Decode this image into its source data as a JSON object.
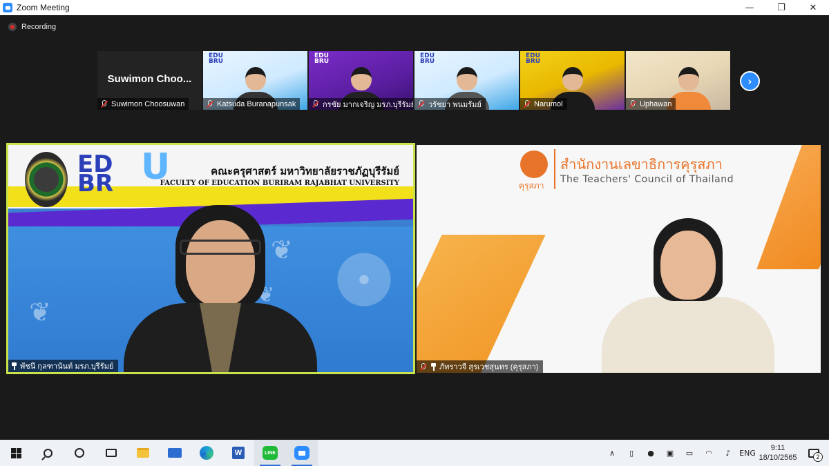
{
  "window": {
    "title": "Zoom Meeting",
    "minimize_glyph": "—",
    "restore_glyph": "❐",
    "close_glyph": "✕"
  },
  "recording": {
    "label": "Recording"
  },
  "thumbnails": [
    {
      "name": "Suwimon Choosuwan",
      "display_text": "Suwimon  Choo...",
      "video": false
    },
    {
      "name": "Katsuda Buranapunsak",
      "video": true
    },
    {
      "name": "กรชัย มากเจริญ มรภ.บุรีรัมย์",
      "video": true
    },
    {
      "name": "วรัชยา พนมรัมย์",
      "video": true
    },
    {
      "name": "Narumol",
      "video": true
    },
    {
      "name": "Uphawan",
      "video": true
    }
  ],
  "next_page_glyph": "›",
  "main_tiles": {
    "left": {
      "name": "พัชนี กุลฑานันท์ มรภ.บุรีรัมย์",
      "faculty_thai": "คณะครุศาสตร์ มหาวิทยาลัยราชภัฏบุรีรัมย์",
      "faculty_english": "FACULTY OF EDUCATION BURIRAM RAJABHAT UNIVERSITY",
      "logo_text_1": "ED",
      "logo_text_2": "BR",
      "logo_text_u": "U"
    },
    "right": {
      "name": "ภัทราวจี สุรเวชสุนทร (คุรุสภา)",
      "org_thai": "สำนักงานเลขาธิการคุรุสภา",
      "org_english": "The Teachers' Council of Thailand",
      "logo_caption": "คุรุสภา"
    }
  },
  "taskbar": {
    "language": "ENG",
    "time": "9:11",
    "date": "18/10/2565",
    "notification_count": "2",
    "word_letter": "W",
    "line_label": "LINE"
  },
  "colors": {
    "active_border": "#c9e34a",
    "zoom_blue": "#2d8cff",
    "teachers_council_orange": "#e8742b"
  }
}
